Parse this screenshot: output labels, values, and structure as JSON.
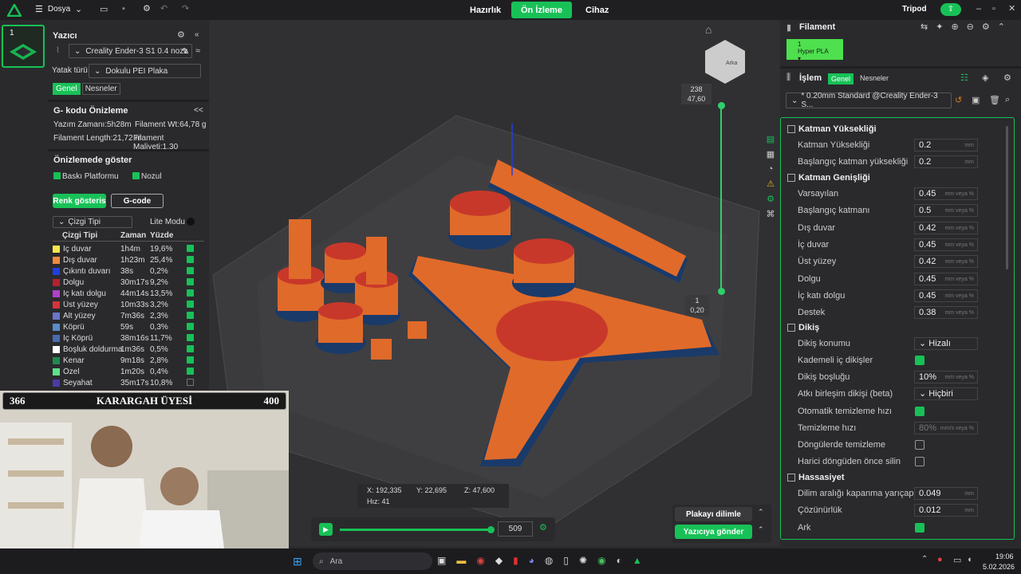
{
  "topbar": {
    "menu_label": "Dosya",
    "tabs": [
      {
        "label": "Hazırlık",
        "active": false
      },
      {
        "label": "Ön İzleme",
        "active": true
      },
      {
        "label": "Cihaz",
        "active": false
      }
    ],
    "user": "Tripod"
  },
  "printer": {
    "index": "1",
    "section_title": "Yazıcı",
    "printer_name": "Creality Ender-3 S1 0.4 nozz",
    "bed_type_label": "Yatak türü",
    "bed_type_value": "Dokulu PEI Plaka",
    "tabs": [
      "Genel",
      "Nesneler"
    ]
  },
  "gcode_preview": {
    "title": "G- kodu Önizleme",
    "collapse": "<<",
    "print_time": "Yazım Zamanı:5h28m",
    "filament_wt": "Filament Wt:64,78 g",
    "filament_length": "Filament Length:21,72 m",
    "filament_cost": "Filament Maliyeti:1,30",
    "show_in_preview": "Önizlemede göster",
    "build_plate": "Baskı Platformu",
    "nozzle": "Nozul",
    "color_btn": "Renk gösteris",
    "gcode_btn": "G-code",
    "line_type": "Çizgi Tipi",
    "lite_mode": "Lite Modu",
    "col_headers": [
      "Çizgi Tipi",
      "Zaman",
      "Yüzde"
    ],
    "rows": [
      {
        "name": "İç duvar",
        "time": "1h4m",
        "pct": "19,6%",
        "color": "#f5e64a",
        "checked": true
      },
      {
        "name": "Dış duvar",
        "time": "1h23m",
        "pct": "25,4%",
        "color": "#f08a3c",
        "checked": true
      },
      {
        "name": "Çıkıntı duvarı",
        "time": "38s",
        "pct": "0,2%",
        "color": "#1f3fe0",
        "checked": true
      },
      {
        "name": "Dolgu",
        "time": "30m17s",
        "pct": "9,2%",
        "color": "#b5222e",
        "checked": true
      },
      {
        "name": "İç katı dolgu",
        "time": "44m14s",
        "pct": "13,5%",
        "color": "#b040c8",
        "checked": true
      },
      {
        "name": "Üst yüzey",
        "time": "10m33s",
        "pct": "3,2%",
        "color": "#d8323c",
        "checked": true
      },
      {
        "name": "Alt yüzey",
        "time": "7m36s",
        "pct": "2,3%",
        "color": "#6a76c8",
        "checked": true
      },
      {
        "name": "Köprü",
        "time": "59s",
        "pct": "0,3%",
        "color": "#5a8cc8",
        "checked": true
      },
      {
        "name": "İç Köprü",
        "time": "38m16s",
        "pct": "11,7%",
        "color": "#4a6ab0",
        "checked": true
      },
      {
        "name": "Boşluk doldurma",
        "time": "1m36s",
        "pct": "0,5%",
        "color": "#ffffff",
        "checked": true
      },
      {
        "name": "Kenar",
        "time": "9m18s",
        "pct": "2,8%",
        "color": "#1e8a50",
        "checked": true
      },
      {
        "name": "Özel",
        "time": "1m20s",
        "pct": "0,4%",
        "color": "#5ee08a",
        "checked": true
      },
      {
        "name": "Seyahat",
        "time": "35m17s",
        "pct": "10,8%",
        "color": "#4a3aa8",
        "checked": false
      }
    ]
  },
  "stream_overlay": {
    "left_num": "366",
    "title": "KARARGAH ÜYESİ",
    "right_num": "400"
  },
  "viewport": {
    "layer_top": "238",
    "layer_top_h": "47,60",
    "layer_bottom": "1",
    "layer_bottom_h": "0,20",
    "view_cube_label": "Arka",
    "coords": {
      "x": "X: 192,335",
      "y": "Y: 22,695",
      "z": "Z: 47,600",
      "speed": "Hız: 41"
    },
    "playback_value": "509",
    "slice_btn": "Plakayı dilimle",
    "send_btn": "Yazıcıya gönder"
  },
  "filament": {
    "title": "Filament",
    "slot": "1",
    "name": "Hyper PLA"
  },
  "process": {
    "title": "İşlem",
    "tabs": [
      "Genel",
      "Nesneler"
    ],
    "preset": "* 0.20mm Standard @Creality Ender-3 S..."
  },
  "params": {
    "layer_height_group": "Katman Yüksekliği",
    "layer_height": {
      "label": "Katman Yüksekliği",
      "value": "0.2",
      "unit": "mm"
    },
    "first_layer_height": {
      "label": "Başlangıç katman yüksekliği",
      "value": "0.2",
      "unit": "mm"
    },
    "line_width_group": "Katman Genişliği",
    "widths": [
      {
        "label": "Varsayılan",
        "value": "0.45",
        "unit": "mm veya %"
      },
      {
        "label": "Başlangıç katmanı",
        "value": "0.5",
        "unit": "mm veya %"
      },
      {
        "label": "Dış duvar",
        "value": "0.42",
        "unit": "mm veya %"
      },
      {
        "label": "İç duvar",
        "value": "0.45",
        "unit": "mm veya %"
      },
      {
        "label": "Üst yüzey",
        "value": "0.42",
        "unit": "mm veya %"
      },
      {
        "label": "Dolgu",
        "value": "0.45",
        "unit": "mm veya %"
      },
      {
        "label": "İç katı dolgu",
        "value": "0.45",
        "unit": "mm veya %"
      },
      {
        "label": "Destek",
        "value": "0.38",
        "unit": "mm veya %"
      }
    ],
    "seam_group": "Dikiş",
    "seam_position": {
      "label": "Dikiş konumu",
      "value": "Hizalı"
    },
    "staggered": {
      "label": "Kademeli iç dikişler"
    },
    "seam_gap": {
      "label": "Dikiş boşluğu",
      "value": "10%",
      "unit": "mm veya %"
    },
    "scarf": {
      "label": "Atkı birleşim dikişi (beta)",
      "value": "Hiçbiri"
    },
    "auto_wipe": {
      "label": "Otomatik temizleme hızı"
    },
    "wipe_speed": {
      "label": "Temizleme hızı",
      "value": "80%",
      "unit": "mm/s veya %"
    },
    "wipe_loops": {
      "label": "Döngülerde temizleme"
    },
    "wipe_before": {
      "label": "Harici döngüden önce silin"
    },
    "precision_group": "Hassasiyet",
    "slice_gap": {
      "label": "Dilim aralığı kapanma yarıçapı",
      "value": "0.049",
      "unit": "mm"
    },
    "resolution": {
      "label": "Çözünürlük",
      "value": "0.012",
      "unit": "mm"
    },
    "arc": {
      "label": "Ark"
    }
  },
  "taskbar": {
    "search_placeholder": "Ara",
    "time": "19:06",
    "date": "5.02.2026"
  }
}
